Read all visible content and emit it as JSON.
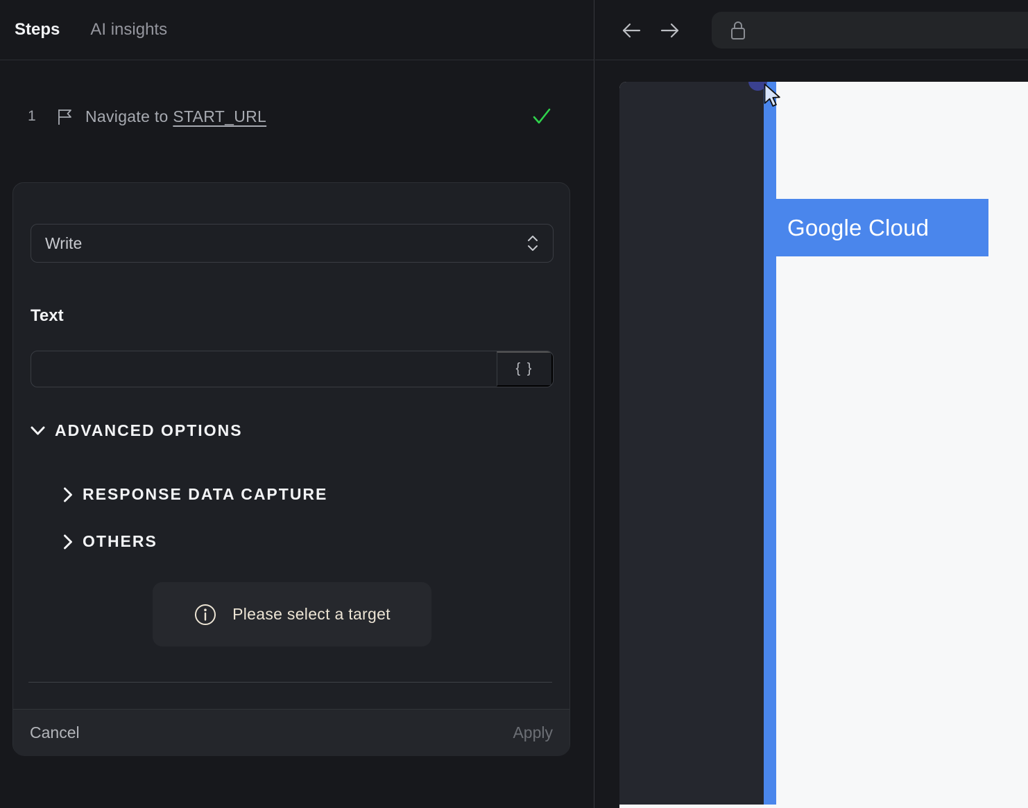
{
  "left_panel": {
    "tabs": {
      "steps": "Steps",
      "ai_insights": "AI insights"
    },
    "step": {
      "index": "1",
      "title": "Navigate to",
      "target": "START_URL",
      "status": "success"
    },
    "editor": {
      "action_select": {
        "value": "Write"
      },
      "text_field": {
        "label": "Text",
        "value": "",
        "placeholder": ""
      },
      "insert_variable_label": "{ }",
      "sections": {
        "advanced_options": "ADVANCED OPTIONS",
        "response_data_capture": "RESPONSE DATA CAPTURE",
        "others": "OTHERS"
      },
      "target_hint": "Please select a target",
      "cancel_label": "Cancel",
      "apply_label": "Apply"
    }
  },
  "browser": {
    "toolbar": {
      "url_value": ""
    },
    "page": {
      "highlighted_element_label": "Google Cloud"
    }
  },
  "icons": {
    "step": "flag-icon",
    "step_status": "check-icon",
    "action_select": "chevron-up-down-icon",
    "advanced_expanded": "chevron-down-icon",
    "section_collapsed": "chevron-right-icon",
    "insert_variable": "braces-glyph",
    "hint": "info-icon",
    "nav_back": "arrow-left-icon",
    "nav_forward": "arrow-right-icon",
    "url_security": "lock-icon",
    "pointer": "cursor-arrow-icon"
  },
  "colors": {
    "panel_bg": "#17181c",
    "card_bg": "#1e2025",
    "accent_blue": "#4a86ec",
    "success_green": "#2fd24c",
    "hint_text": "#ece4d4",
    "selection_dot": "#3a4190",
    "page_bg": "#f7f8f9",
    "drawer_bg": "#25272e"
  }
}
